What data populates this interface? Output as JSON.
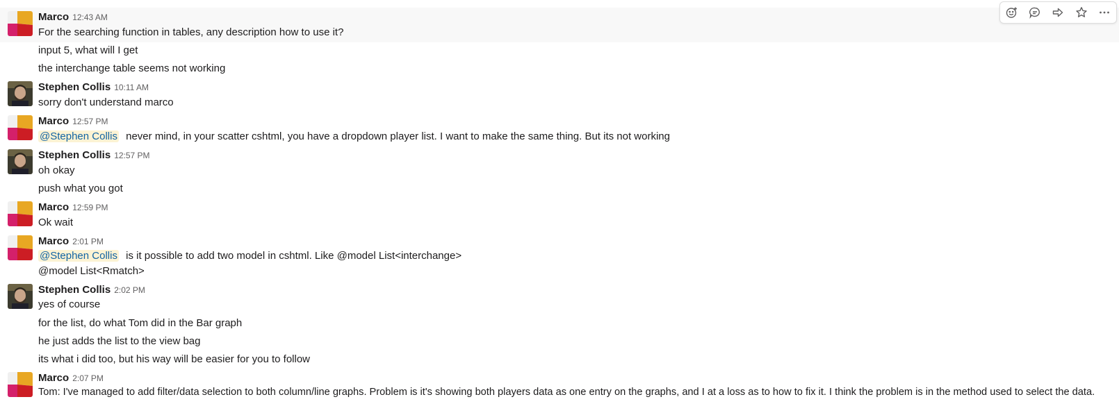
{
  "messages": [
    {
      "author": "Marco",
      "time": "12:43 AM",
      "lines": [
        "For the searching function in tables, any description how to use it?",
        "input 5, what will I get",
        "the interchange table seems not working"
      ]
    },
    {
      "author": "Stephen Collis",
      "time": "10:11 AM",
      "lines": [
        "sorry don't understand marco"
      ]
    },
    {
      "author": "Marco",
      "time": "12:57 PM",
      "mention": "@Stephen Collis",
      "lines": [
        "never mind, in your scatter cshtml, you have a dropdown player list. I want to make the same thing. But its not working"
      ]
    },
    {
      "author": "Stephen Collis",
      "time": "12:57 PM",
      "lines": [
        "oh okay",
        "push what you got"
      ]
    },
    {
      "author": "Marco",
      "time": "12:59 PM",
      "lines": [
        "Ok wait"
      ]
    },
    {
      "author": "Marco",
      "time": "2:01 PM",
      "mention": "@Stephen Collis",
      "lines": [
        "is it possible to add two model in cshtml. Like @model List<interchange>",
        "@model List<Rmatch>"
      ]
    },
    {
      "author": "Stephen Collis",
      "time": "2:02 PM",
      "lines": [
        "yes of course",
        "for the list, do what Tom did in the Bar graph",
        "he just adds the list to the view bag",
        "its what i did too, but his way will be easier for you to follow"
      ]
    },
    {
      "author": "Marco",
      "time": "2:07 PM",
      "lines": [
        "Tom: I've managed to add filter/data selection to both column/line graphs. Problem is it's showing both players data as one entry on the graphs, and I at a loss as to how to fix it. I think the problem is in the method used to select the data."
      ]
    }
  ],
  "actions": [
    "add-reaction-icon",
    "reply-thread-icon",
    "share-icon",
    "star-icon",
    "more-actions-icon"
  ],
  "colors": {
    "mention_bg": "#fcf3d4",
    "mention_text": "#1264a3",
    "hover_bg": "#f8f8f8"
  }
}
